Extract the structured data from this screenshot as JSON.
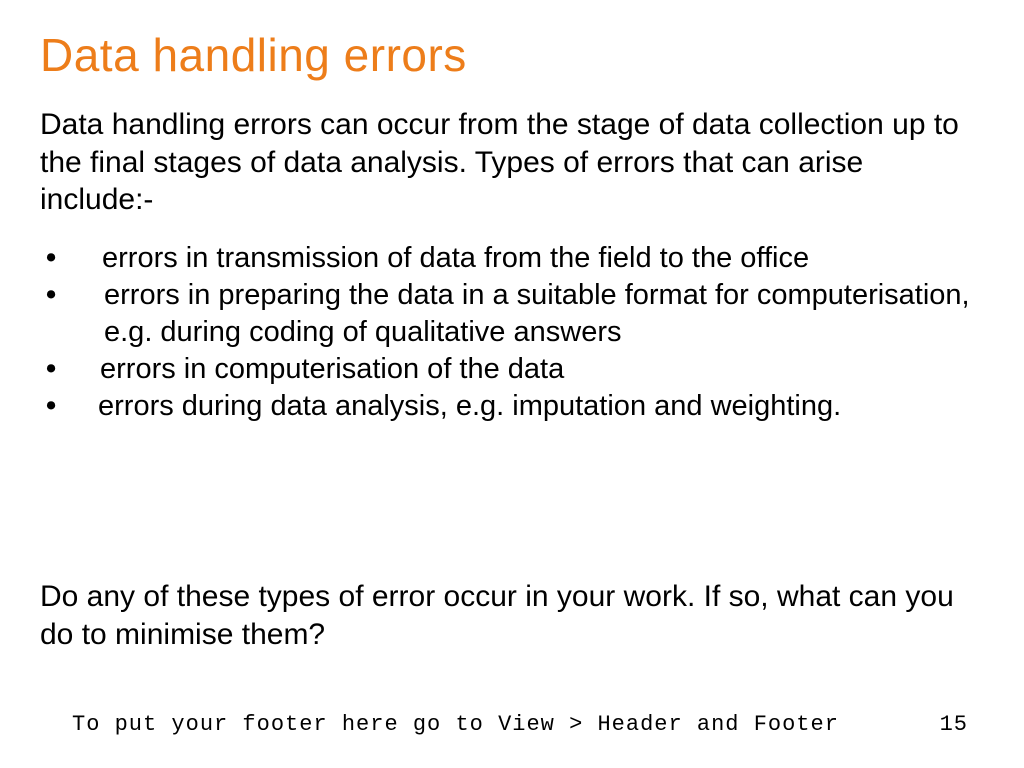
{
  "title": "Data handling errors",
  "intro": "Data handling errors can occur from the stage of data collection up to the final stages of data analysis. Types of errors that can arise include:-",
  "bullets": [
    "errors in transmission of data from the field to the office",
    "errors in preparing the data in a suitable format for computerisation, e.g. during coding of qualitative answers",
    "errors in computerisation of the data",
    "errors during data analysis, e.g. imputation and weighting."
  ],
  "question": "Do any of these types of error occur in your work.  If so, what can you do to minimise them?",
  "footer": {
    "text": "To put your footer here go to View > Header and Footer",
    "page": "15"
  },
  "colors": {
    "title": "#ed7d1a",
    "body": "#000000",
    "background": "#ffffff"
  }
}
